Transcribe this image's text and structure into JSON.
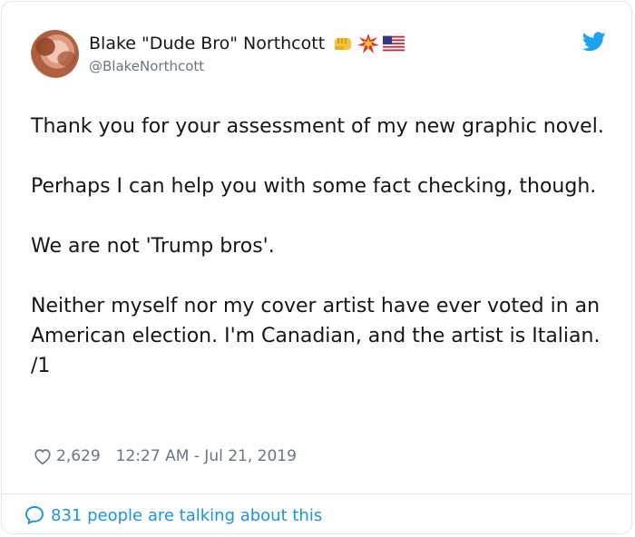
{
  "tweet": {
    "display_name": "Blake \"Dude Bro\" Northcott",
    "name_emojis": [
      "fist-emoji",
      "collision-emoji",
      "us-flag-emoji"
    ],
    "handle": "@BlakeNorthcott",
    "paragraphs": [
      "Thank you for your assessment of my new graphic novel.",
      "Perhaps I can help you with some fact checking, though.",
      "We are not 'Trump bros'.",
      "Neither myself nor my cover artist have ever voted in an American election. I'm Canadian, and the artist is Italian. /1"
    ],
    "likes": "2,629",
    "timestamp": "12:27 AM - Jul 21, 2019",
    "talking": "831 people are talking about this"
  },
  "colors": {
    "link": "#1b95e0",
    "muted": "#657786",
    "text": "#14171a",
    "border": "#e1e8ed"
  },
  "icons": [
    "twitter-bird-icon",
    "heart-icon",
    "reply-bubble-icon"
  ]
}
